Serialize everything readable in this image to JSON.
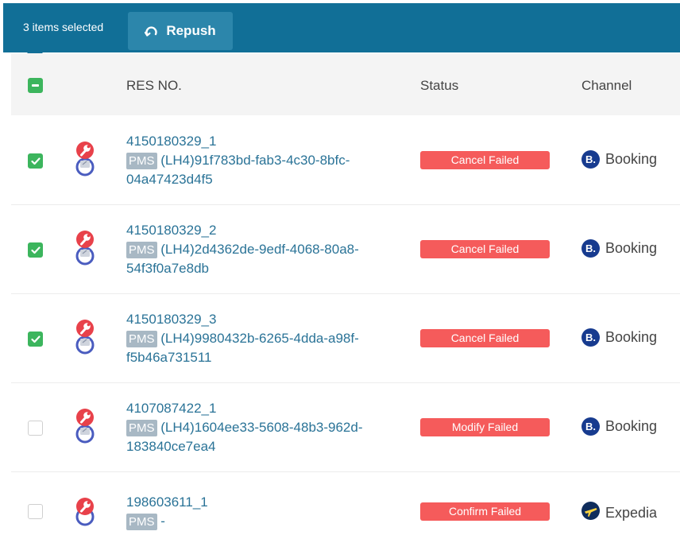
{
  "toolbar": {
    "selection_text": "3 items selected",
    "repush_label": "Repush",
    "repush_icon": "refresh-icon"
  },
  "columns": {
    "res_no": "RES NO.",
    "status": "Status",
    "channel": "Channel"
  },
  "header_checkbox_state": "partial",
  "rows": [
    {
      "checked": true,
      "res_no": "4150180329_1",
      "pms_badge": "PMS",
      "pms_line1": "(LH4)91f783bd-fab3-4c30-8bfc-",
      "pms_line2": "04a47423d4f5",
      "status": "Cancel Failed",
      "channel": "Booking",
      "channel_logo": "B."
    },
    {
      "checked": true,
      "res_no": "4150180329_2",
      "pms_badge": "PMS",
      "pms_line1": "(LH4)2d4362de-9edf-4068-80a8-",
      "pms_line2": "54f3f0a7e8db",
      "status": "Cancel Failed",
      "channel": "Booking",
      "channel_logo": "B."
    },
    {
      "checked": true,
      "res_no": "4150180329_3",
      "pms_badge": "PMS",
      "pms_line1": "(LH4)9980432b-6265-4dda-a98f-",
      "pms_line2": "f5b46a731511",
      "status": "Cancel Failed",
      "channel": "Booking",
      "channel_logo": "B."
    },
    {
      "checked": false,
      "res_no": "4107087422_1",
      "pms_badge": "PMS",
      "pms_line1": "(LH4)1604ee33-5608-48b3-962d-",
      "pms_line2": "183840ce7ea4",
      "status": "Modify Failed",
      "channel": "Booking",
      "channel_logo": "B."
    },
    {
      "checked": false,
      "res_no": "198603611_1",
      "pms_badge": "PMS",
      "pms_line1": "-",
      "pms_line2": "",
      "status": "Confirm Failed",
      "channel": "Expedia",
      "channel_logo": ""
    }
  ],
  "colors": {
    "topbar": "#116f97",
    "repush_button": "#2c86ab",
    "checkbox_checked": "#3cb55d",
    "status_failed": "#f55b5b",
    "link": "#2a7397",
    "pms_badge": "#a8b8c4",
    "booking_logo": "#173b8f",
    "expedia_logo": "#0f2d5c"
  }
}
